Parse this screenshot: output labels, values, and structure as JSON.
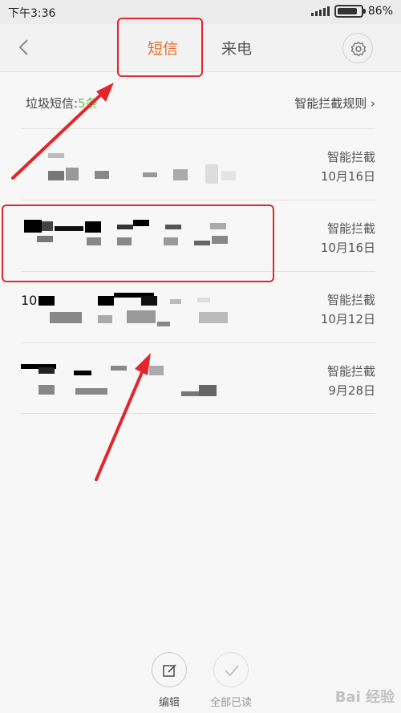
{
  "status_bar": {
    "time": "下午3:36",
    "battery": "86%",
    "battery_level": 0.86
  },
  "header": {
    "tabs": [
      {
        "label": "短信",
        "active": true
      },
      {
        "label": "来电",
        "active": false
      }
    ]
  },
  "spam": {
    "label": "垃圾短信:",
    "count": "5条",
    "rules_link": "智能拦截规则"
  },
  "messages": [
    {
      "tag": "智能拦截",
      "date": "10月16日",
      "snippet": ""
    },
    {
      "tag": "智能拦截",
      "date": "10月16日",
      "snippet": ""
    },
    {
      "tag": "智能拦截",
      "date": "10月12日",
      "snippet": "10"
    },
    {
      "tag": "智能拦截",
      "date": "9月28日",
      "snippet": ""
    }
  ],
  "actions": {
    "edit": "编辑",
    "mark_all_read": "全部已读"
  },
  "watermark": "Bai 经验",
  "colors": {
    "accent": "#e66b2e",
    "annotation": "#e2262b",
    "count_green": "#6ac04a"
  }
}
